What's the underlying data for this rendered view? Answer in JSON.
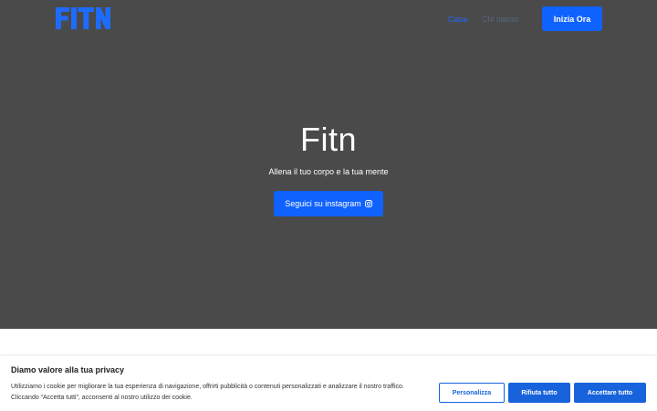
{
  "header": {
    "logo_text": "FITN",
    "nav": [
      {
        "label": "Casa"
      },
      {
        "label": "Chi siamo"
      }
    ],
    "cta_label": "Inizia Ora"
  },
  "hero": {
    "title": "Fitn",
    "subtitle": "Allena il tuo corpo e la tua mente",
    "button_label": "Seguici su instagram",
    "button_icon": "instagram-icon"
  },
  "cookie_banner": {
    "title": "Diamo valore alla tua privacy",
    "text": "Utilizziamo i cookie per migliorare la tua esperienza di navigazione, offrirti pubblicità o contenuti personalizzati e analizzare il nostro traffico. Cliccando “Accetta tutti”, acconsenti al nostro utilizzo dei cookie.",
    "buttons": {
      "customize": "Personalizza",
      "reject": "Rifiuta tutto",
      "accept": "Accettare tutto"
    }
  },
  "colors": {
    "brand_blue": "#0f62fe",
    "hero_background": "#4a4a4a",
    "cookie_button_blue": "#1863dc"
  }
}
